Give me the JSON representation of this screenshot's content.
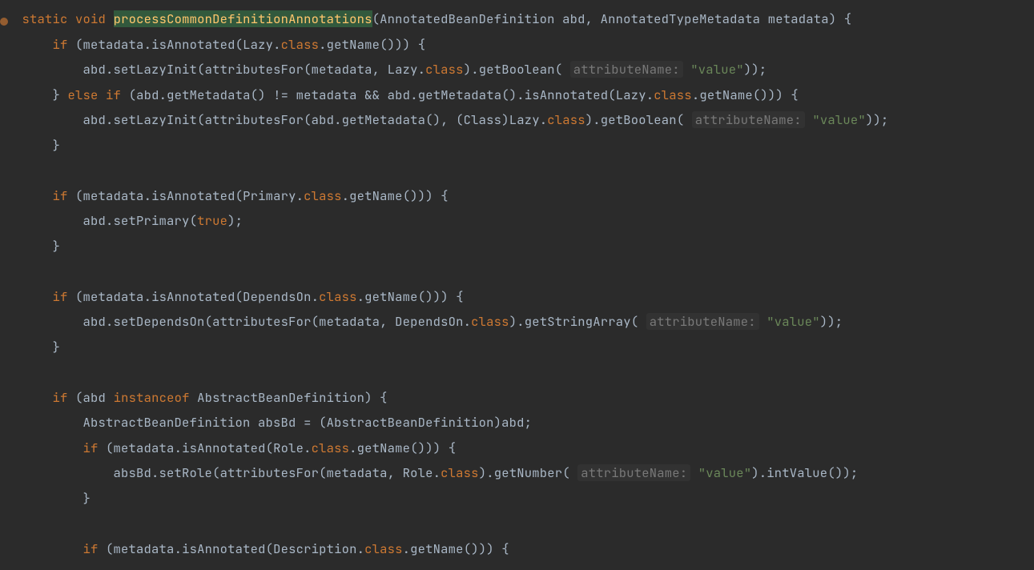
{
  "code": {
    "kw_static": "static",
    "kw_void": "void",
    "kw_if": "if",
    "kw_else": "else",
    "kw_class": "class",
    "kw_true": "true",
    "kw_instanceof": "instanceof",
    "method_decl": "processCommonDefinitionAnnotations",
    "type_AnnotatedBeanDefinition": "AnnotatedBeanDefinition",
    "param_abd": "abd",
    "type_AnnotatedTypeMetadata": "AnnotatedTypeMetadata",
    "param_metadata": "metadata",
    "m_isAnnotated": "isAnnotated",
    "t_Lazy": "Lazy",
    "t_Primary": "Primary",
    "t_DependsOn": "DependsOn",
    "t_Role": "Role",
    "t_Description": "Description",
    "t_AbstractBeanDefinition": "AbstractBeanDefinition",
    "m_getName": "getName",
    "m_setLazyInit": "setLazyInit",
    "m_attributesFor": "attributesFor",
    "m_getBoolean": "getBoolean",
    "m_getMetadata": "getMetadata",
    "m_setPrimary": "setPrimary",
    "m_setDependsOn": "setDependsOn",
    "m_getStringArray": "getStringArray",
    "m_setRole": "setRole",
    "m_getNumber": "getNumber",
    "m_intValue": "intValue",
    "var_absBd": "absBd",
    "cast_Class": "Class",
    "hint_attributeName": "attributeName:",
    "str_value": "\"value\""
  }
}
